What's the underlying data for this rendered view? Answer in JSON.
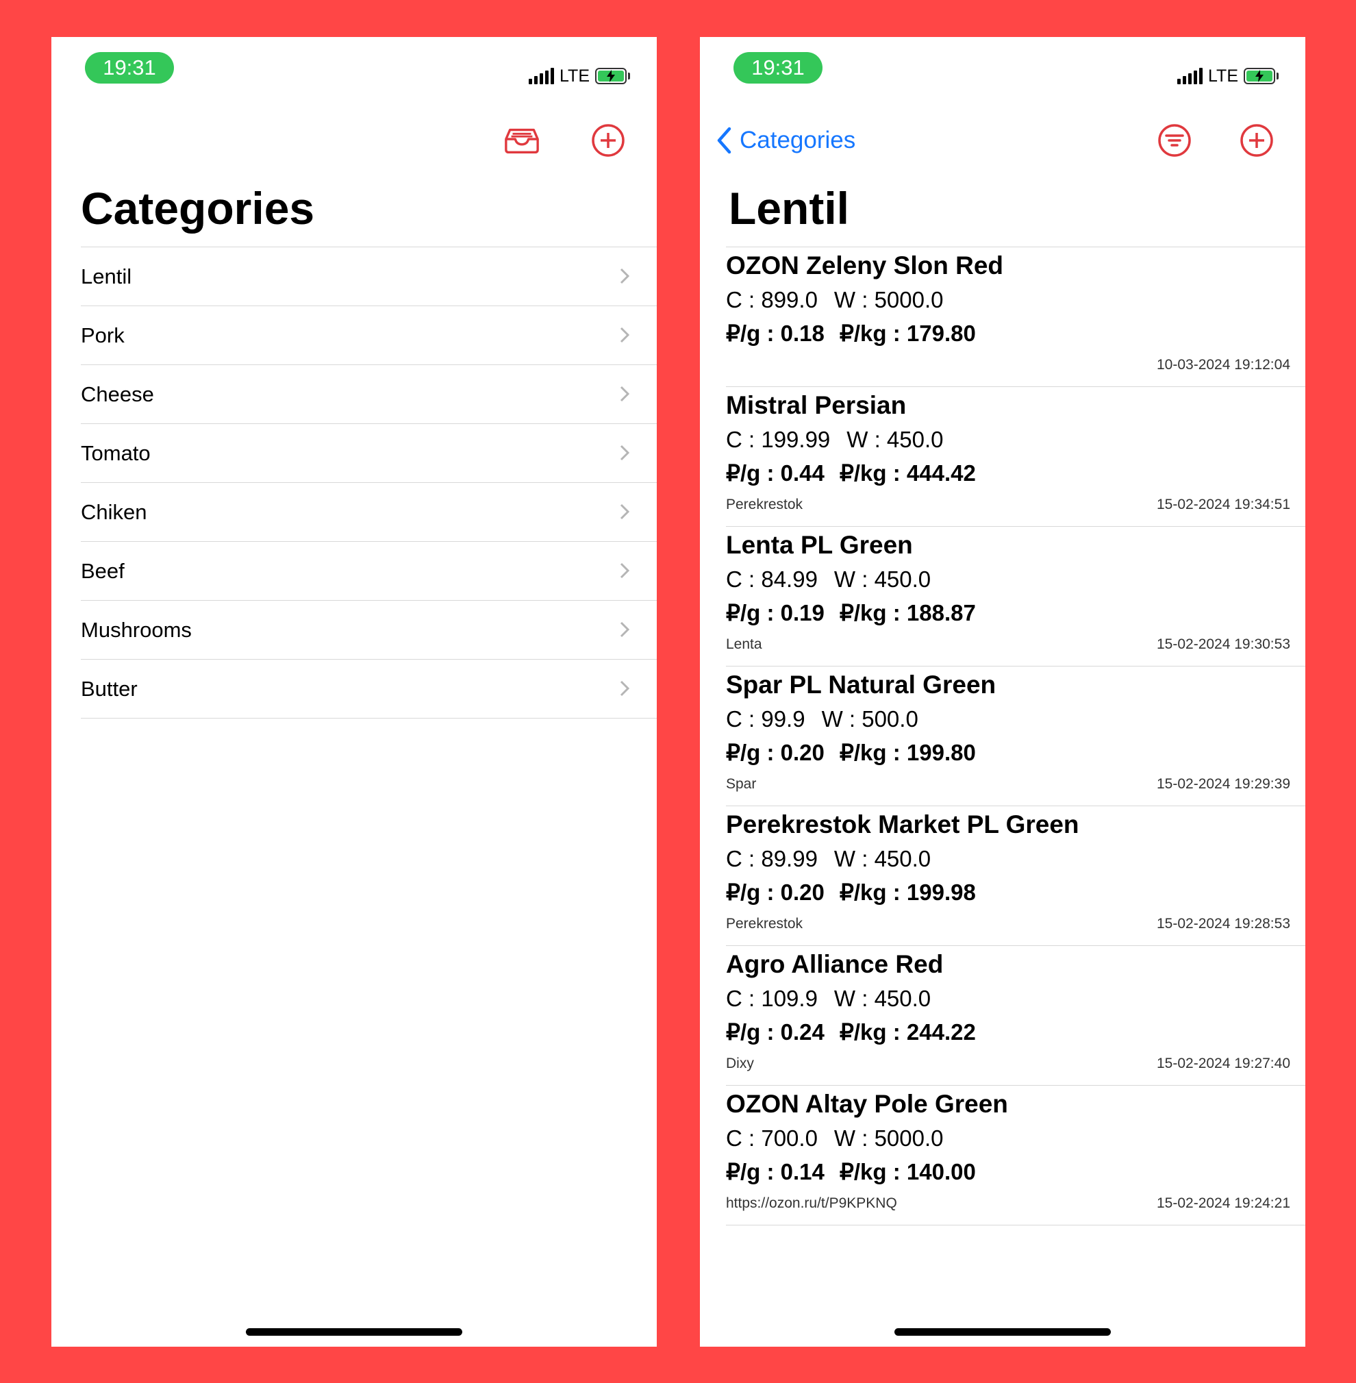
{
  "left": {
    "status": {
      "time": "19:31",
      "network": "LTE"
    },
    "title": "Categories",
    "categories": [
      "Lentil",
      "Pork",
      "Cheese",
      "Tomato",
      "Chiken",
      "Beef",
      "Mushrooms",
      "Butter"
    ]
  },
  "right": {
    "status": {
      "time": "19:31",
      "network": "LTE"
    },
    "back_label": "Categories",
    "title": "Lentil",
    "items": [
      {
        "name": "OZON Zeleny Slon Red",
        "cost": "C : 899.0",
        "weight": "W : 5000.0",
        "per_g": "₽/g : 0.18",
        "per_kg": "₽/kg : 179.80",
        "store": "",
        "date": "10-03-2024 19:12:04"
      },
      {
        "name": "Mistral Persian",
        "cost": "C : 199.99",
        "weight": "W : 450.0",
        "per_g": "₽/g : 0.44",
        "per_kg": "₽/kg : 444.42",
        "store": "Perekrestok",
        "date": "15-02-2024 19:34:51"
      },
      {
        "name": "Lenta PL Green",
        "cost": "C : 84.99",
        "weight": "W : 450.0",
        "per_g": "₽/g : 0.19",
        "per_kg": "₽/kg : 188.87",
        "store": "Lenta",
        "date": "15-02-2024 19:30:53"
      },
      {
        "name": "Spar PL Natural Green",
        "cost": "C : 99.9",
        "weight": "W : 500.0",
        "per_g": "₽/g : 0.20",
        "per_kg": "₽/kg : 199.80",
        "store": "Spar",
        "date": "15-02-2024 19:29:39"
      },
      {
        "name": "Perekrestok Market PL Green",
        "cost": "C : 89.99",
        "weight": "W : 450.0",
        "per_g": "₽/g : 0.20",
        "per_kg": "₽/kg : 199.98",
        "store": "Perekrestok",
        "date": "15-02-2024 19:28:53"
      },
      {
        "name": "Agro Alliance Red",
        "cost": "C : 109.9",
        "weight": "W : 450.0",
        "per_g": "₽/g : 0.24",
        "per_kg": "₽/kg : 244.22",
        "store": "Dixy",
        "date": "15-02-2024 19:27:40"
      },
      {
        "name": "OZON Altay Pole Green",
        "cost": "C : 700.0",
        "weight": "W : 5000.0",
        "per_g": "₽/g : 0.14",
        "per_kg": "₽/kg : 140.00",
        "store": "https://ozon.ru/t/P9KPKNQ",
        "date": "15-02-2024 19:24:21"
      }
    ]
  },
  "icons": {
    "archive": "archive-tray-icon",
    "add": "plus-circle-icon",
    "filter": "filter-circle-icon",
    "back": "chevron-left-icon",
    "chevron": "chevron-right-icon"
  },
  "colors": {
    "background": "#FF4646",
    "accent": "#E0393E",
    "link": "#1677FF",
    "status_green": "#34C759"
  }
}
